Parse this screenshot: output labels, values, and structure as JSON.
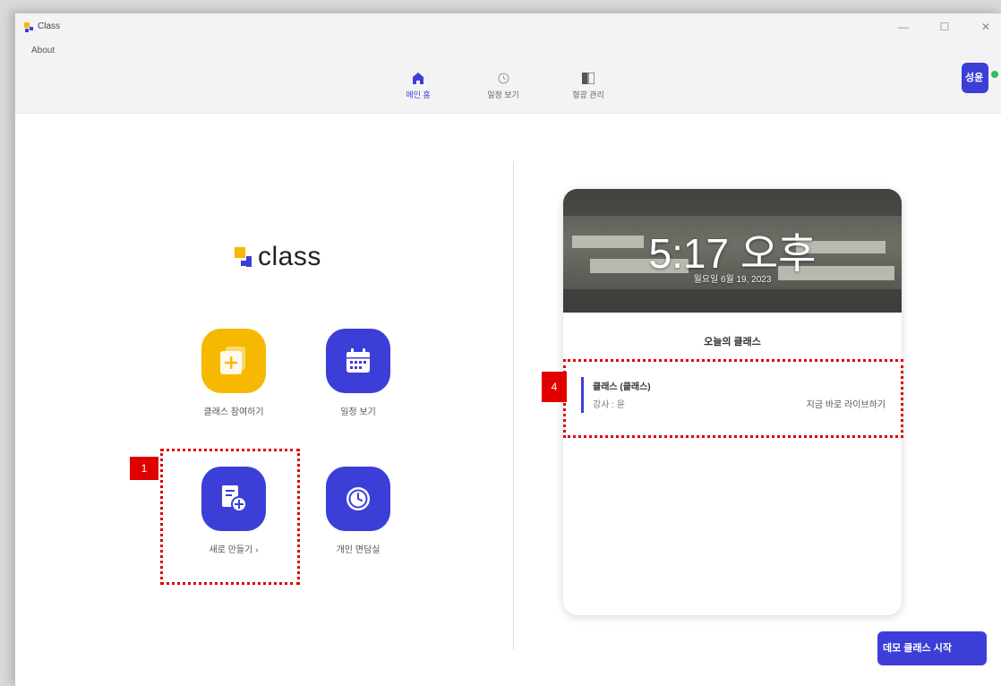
{
  "window": {
    "title": "Class",
    "minimize": "—",
    "maximize": "☐",
    "close": "✕"
  },
  "menu": {
    "about": "About"
  },
  "nav": {
    "items": [
      {
        "label": "메인 홈",
        "icon": "home-icon",
        "active": true
      },
      {
        "label": "일정 보기",
        "icon": "clock-icon",
        "active": false
      },
      {
        "label": "형광 관리",
        "icon": "book-icon",
        "active": false
      }
    ],
    "avatar": "성윤"
  },
  "logo": {
    "text": "class"
  },
  "tiles": [
    {
      "label": "클래스 참여하기",
      "icon": "plus-icon",
      "color": "#f6b800"
    },
    {
      "label": "일정 보기",
      "icon": "calendar-icon",
      "color": "#3b3fd8"
    },
    {
      "label": "새로 만들기 ›",
      "icon": "new-document-icon",
      "color": "#3b3fd8"
    },
    {
      "label": "개인 면담실",
      "icon": "clock-icon",
      "color": "#3b3fd8"
    }
  ],
  "card": {
    "time": "5:17 오후",
    "date": "월요일 6월 19, 2023",
    "heading": "오늘의 클래스",
    "class_item": {
      "title": "클래스 (클래스)",
      "subtitle": "강사 : 윤",
      "action": "지금 바로 라이브하기"
    }
  },
  "annotations": {
    "badge_1": "1",
    "badge_4": "4"
  },
  "demo_button": "데모 클래스 시작",
  "colors": {
    "accent": "#3b3fd8",
    "yellow": "#f6b800",
    "annotation_red": "#e00000"
  }
}
